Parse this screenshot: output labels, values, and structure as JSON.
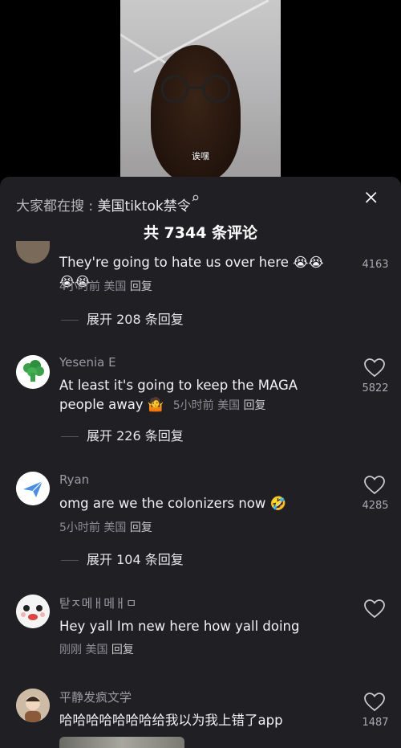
{
  "video": {
    "caption": "诶嘿"
  },
  "sheet": {
    "search_prefix": "大家都在搜 : ",
    "search_keyword": "美国tiktok禁令",
    "search_icon": "search-icon",
    "title": "共 7344 条评论",
    "close_icon": "close-icon"
  },
  "comments": [
    {
      "name": "",
      "text": "They're going to hate us over here 😭😭😭😭",
      "time": "4小时前",
      "location": "美国",
      "reply": "回复",
      "likes": "4163",
      "expand": "展开 208 条回复"
    },
    {
      "name": "Yesenia E",
      "text": "At least it's going to keep the MAGA people away 🤷",
      "time": "5小时前",
      "location": "美国",
      "reply": "回复",
      "likes": "5822",
      "expand": "展开 226 条回复"
    },
    {
      "name": "Ryan",
      "text": "omg are we the colonizers now 🤣",
      "time": "5小时前",
      "location": "美国",
      "reply": "回复",
      "likes": "4285",
      "expand": "展开 104 条回复"
    },
    {
      "name": "탇ㅈ메ㅐ메ㅐㅁ",
      "text": "Hey yall Im new here how yall doing",
      "time": "刚刚",
      "location": "美国",
      "reply": "回复",
      "likes": ""
    },
    {
      "name": "平静发疯文学",
      "text": "哈哈哈哈哈哈哈给我以为我上错了app",
      "likes": "1487"
    }
  ],
  "colors": {
    "sheet_bg": "#1f1f24",
    "text": "#f2f2f4",
    "muted": "#8d8d93"
  }
}
